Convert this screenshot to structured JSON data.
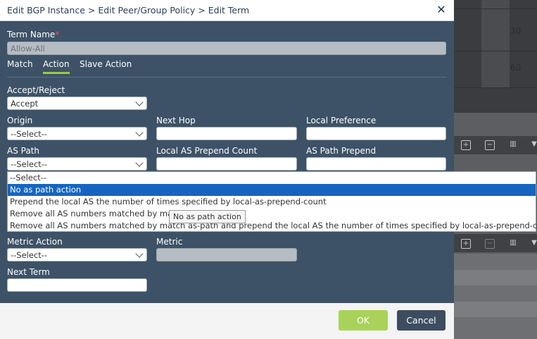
{
  "dialog": {
    "title": "Edit BGP Instance > Edit Peer/Group Policy > Edit Term",
    "close_icon": "close-icon"
  },
  "term_name": {
    "label": "Term Name",
    "required_mark": "*",
    "value": "Allow-All"
  },
  "tabs": [
    {
      "label": "Match",
      "active": false
    },
    {
      "label": "Action",
      "active": true
    },
    {
      "label": "Slave Action",
      "active": false
    }
  ],
  "accept_reject": {
    "label": "Accept/Reject",
    "value": "Accept"
  },
  "origin": {
    "label": "Origin",
    "value": "--Select--"
  },
  "next_hop": {
    "label": "Next Hop",
    "value": ""
  },
  "local_preference": {
    "label": "Local Preference",
    "value": ""
  },
  "as_path": {
    "label": "AS Path",
    "value": "--Select--"
  },
  "local_as_prepend_count": {
    "label": "Local AS Prepend Count",
    "value": ""
  },
  "as_path_prepend": {
    "label": "AS Path Prepend",
    "value": ""
  },
  "as_path_dropdown": {
    "options": [
      "--Select--",
      "No as path action",
      "Prepend the local AS the number of times specified by local-as-prepend-count",
      "Remove all AS numbers matched by match as-path",
      "Remove all AS numbers matched by match as-path and prepend the local AS the number of times specified by local-as-prepend-count"
    ],
    "highlighted_index": 1,
    "tooltip": "No as path action"
  },
  "metric_action": {
    "label": "Metric Action",
    "value": "--Select--"
  },
  "metric": {
    "label": "Metric",
    "value": ""
  },
  "next_term": {
    "label": "Next Term",
    "value": ""
  },
  "footer": {
    "ok_label": "OK",
    "cancel_label": "Cancel"
  },
  "background": {
    "values": [
      "30",
      "60"
    ]
  },
  "colors": {
    "accent_green": "#a9d25a",
    "body_bg": "#3d5267",
    "highlight_blue": "#1565c0"
  }
}
